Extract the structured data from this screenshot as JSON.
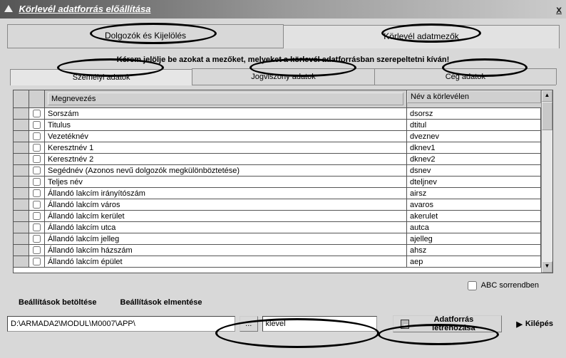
{
  "window": {
    "title": "Körlevél adatforrás előállítása"
  },
  "outer_tabs": {
    "tab1": "Dolgozók és Kijelölés",
    "tab2": "Körlevél adatmezők"
  },
  "instruction": "Kérem jelölje be azokat a mezőket, melyeket a körlevél adatforrásban szerepeltetni kíván!",
  "inner_tabs": {
    "tab1": "Személyi adatok",
    "tab2": "Jogviszony adatok",
    "tab3": "Cég adatok"
  },
  "table": {
    "header_name": "Megnevezés",
    "header_label": "Név a körlevélen",
    "rows": [
      {
        "name": "Sorszám",
        "label": "dsorsz"
      },
      {
        "name": "Titulus",
        "label": "dtitul"
      },
      {
        "name": "Vezetéknév",
        "label": "dveznev"
      },
      {
        "name": "Keresztnév 1",
        "label": "dknev1"
      },
      {
        "name": "Keresztnév 2",
        "label": "dknev2"
      },
      {
        "name": "Segédnév (Azonos nevű dolgozók megkülönböztetése)",
        "label": "dsnev"
      },
      {
        "name": "Teljes név",
        "label": "dteljnev"
      },
      {
        "name": "Állandó lakcím irányítószám",
        "label": "airsz"
      },
      {
        "name": "Állandó lakcím város",
        "label": "avaros"
      },
      {
        "name": "Állandó lakcím kerület",
        "label": "akerulet"
      },
      {
        "name": "Állandó lakcím utca",
        "label": "autca"
      },
      {
        "name": "Állandó lakcím jelleg",
        "label": "ajelleg"
      },
      {
        "name": "Állandó lakcím házszám",
        "label": "ahsz"
      },
      {
        "name": "Állandó lakcím épület",
        "label": "aep"
      }
    ]
  },
  "abc_checkbox": "ABC sorrendben",
  "links": {
    "load": "Beállítások betöltése",
    "save": "Beállítások elmentése"
  },
  "bottom": {
    "path_value": "D:\\ARMADA2\\MODUL\\M0007\\APP\\",
    "browse": "...",
    "file_value": "klevel",
    "create": "Adatforrás létrehozása",
    "exit": "Kilépés"
  }
}
